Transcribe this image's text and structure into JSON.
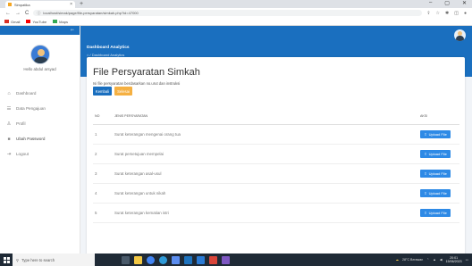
{
  "browser": {
    "tab_title": "Simpatika",
    "url": "localhost/simak/page/file-persyaratan/simkah.php?id=47000",
    "nav": {
      "back": "←",
      "forward": "→",
      "reload": "C"
    },
    "bookmarks": [
      {
        "label": "Gmail",
        "color": "#d93025"
      },
      {
        "label": "YouTube",
        "color": "#ff0000"
      },
      {
        "label": "Maps",
        "color": "#34a853"
      }
    ]
  },
  "sidebar": {
    "user_greeting": "Hello abdul arsyad",
    "menu": [
      {
        "label": "Dashboard",
        "icon": "⌂",
        "icon_name": "home-icon"
      },
      {
        "label": "Data Pengajuan",
        "icon": "☰",
        "icon_name": "list-icon"
      },
      {
        "label": "Profil",
        "icon": "♙",
        "icon_name": "user-icon"
      },
      {
        "label": "Ubah Password",
        "icon": "🔒",
        "icon_name": "lock-icon"
      },
      {
        "label": "Logout",
        "icon": "⇥",
        "icon_name": "logout-icon"
      }
    ]
  },
  "header": {
    "title": "Dashboard Analytics",
    "breadcrumb": "⌂ / Dashboard Analytics"
  },
  "page": {
    "title": "File Persyaratan Simkah",
    "subtitle": "Isi file persyaratan berdasarkan no.urut dan instruksi",
    "back_label": "Kembali",
    "done_label": "Selesai"
  },
  "table": {
    "headers": {
      "no": "NO",
      "name": "JENIS PERSYARATAN",
      "action": "AKSI"
    },
    "rows": [
      {
        "no": "1",
        "name": "Surat keterangan mengenai orang tua",
        "action": "Upload File"
      },
      {
        "no": "2",
        "name": "Surat persetujuan mempelai",
        "action": "Upload File"
      },
      {
        "no": "3",
        "name": "Surat keterangan asal-usul",
        "action": "Upload File"
      },
      {
        "no": "4",
        "name": "Surat keterangan untuk nikah",
        "action": "Upload File"
      },
      {
        "no": "5",
        "name": "Surat keterangan kematian istri",
        "action": "Upload File"
      }
    ]
  },
  "taskbar": {
    "search_placeholder": "Type here to search",
    "weather": "28°C Berawan",
    "time": "20:01",
    "date": "15/06/2023",
    "colors": {
      "bar": "#1f2a36",
      "accent": "#1a6fbf"
    }
  }
}
